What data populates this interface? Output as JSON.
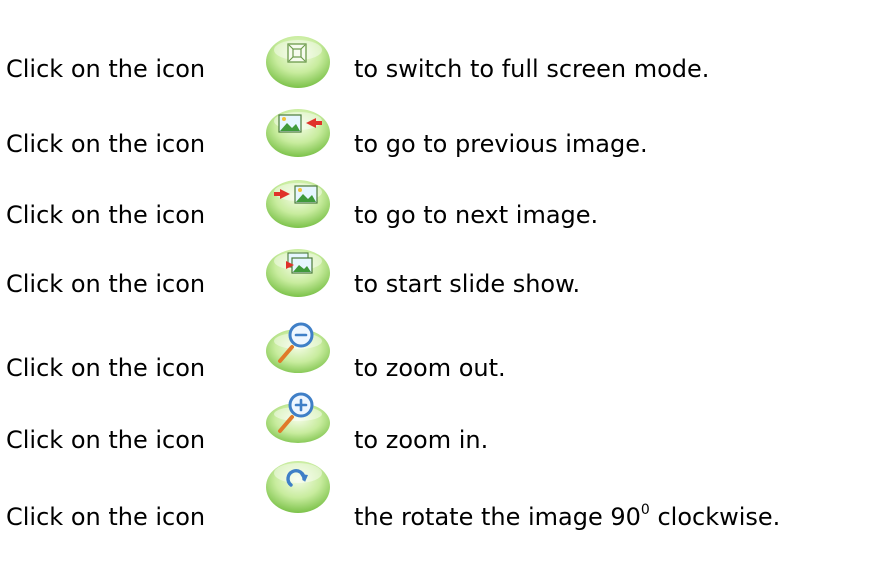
{
  "rows": [
    {
      "prefix": "Click on the icon",
      "icon": "fullscreen-icon",
      "suffix": "to switch to full screen mode."
    },
    {
      "prefix": "Click on the icon",
      "icon": "previous-image-icon",
      "suffix": "to go to previous image."
    },
    {
      "prefix": "Click on the icon",
      "icon": "next-image-icon",
      "suffix": "to go to next image."
    },
    {
      "prefix": "Click on the icon",
      "icon": "slideshow-icon",
      "suffix": "to start slide show."
    },
    {
      "prefix": "Click on the icon",
      "icon": "zoom-out-icon",
      "suffix": "to zoom out."
    },
    {
      "prefix": "Click on the icon",
      "icon": "zoom-in-icon",
      "suffix": "to zoom in."
    },
    {
      "prefix": "Click on the icon",
      "icon": "rotate-clockwise-icon",
      "suffix": "the rotate the image 90",
      "suffix_sup": "0",
      "suffix_end": " clockwise."
    }
  ],
  "colors": {
    "button_light": "#eaf8d0",
    "button_mid": "#b8e48a",
    "button_dark": "#7cc24a",
    "arrow_red": "#e0322a",
    "arrow_orange": "#e8902a",
    "magnifier_blue": "#3f7fc7",
    "handle_orange": "#e07a2a"
  }
}
